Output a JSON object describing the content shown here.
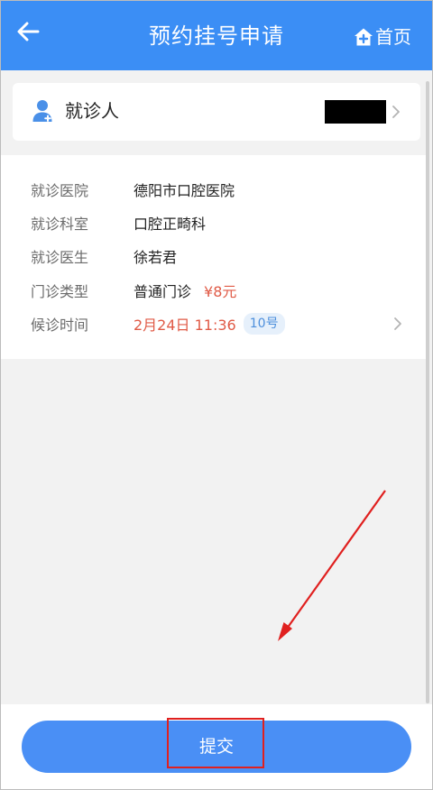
{
  "header": {
    "title": "预约挂号申请",
    "home_label": "首页",
    "back_icon": "back-arrow-icon",
    "home_icon": "home-plus-icon",
    "background_color": "#3b8ef5"
  },
  "patient": {
    "label": "就诊人",
    "value_redacted": true
  },
  "details": {
    "hospital_label": "就诊医院",
    "hospital_value": "德阳市口腔医院",
    "department_label": "就诊科室",
    "department_value": "口腔正畸科",
    "doctor_label": "就诊医生",
    "doctor_value": "徐若君",
    "type_label": "门诊类型",
    "type_value": "普通门诊",
    "price": "¥8元",
    "time_label": "候诊时间",
    "time_value": "2月24日 11:36",
    "queue_number": "10号"
  },
  "footer": {
    "submit_label": "提交",
    "button_color": "#4a8ff5"
  },
  "annotation": {
    "color": "#e0201f"
  }
}
